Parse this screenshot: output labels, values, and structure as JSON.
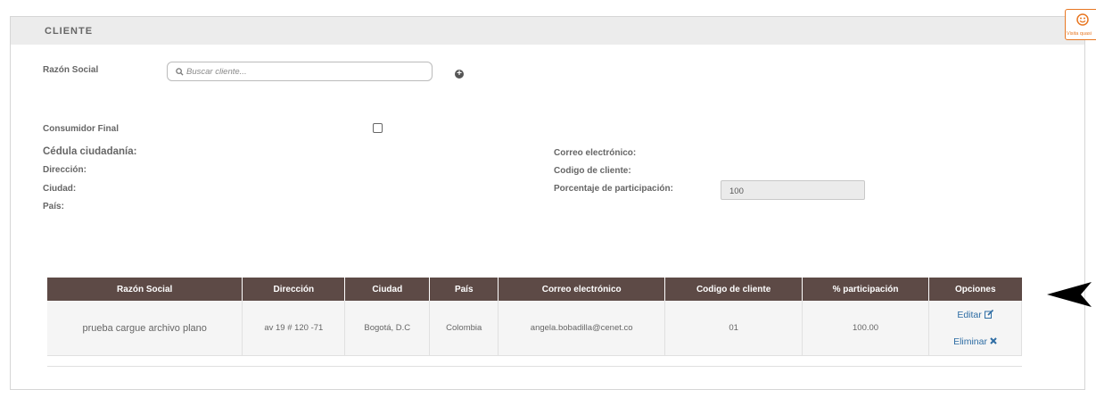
{
  "panel": {
    "title": "CLIENTE"
  },
  "form": {
    "razon_social_label": "Razón Social",
    "search_placeholder": "Buscar cliente...",
    "consumidor_final_label": "Consumidor Final",
    "cedula_label": "Cédula ciudadanía:",
    "direccion_label": "Dirección:",
    "ciudad_label": "Ciudad:",
    "pais_label": "País:",
    "correo_label": "Correo electrónico:",
    "codigo_label": "Codigo de cliente:",
    "porcentaje_label": "Porcentaje de participación:",
    "porcentaje_value": "100"
  },
  "table": {
    "headers": [
      "Razón Social",
      "Dirección",
      "Ciudad",
      "País",
      "Correo electrónico",
      "Codigo de cliente",
      "% participación",
      "Opciones"
    ],
    "rows": [
      {
        "razon_social": "prueba cargue archivo plano",
        "direccion": "av 19 # 120 -71",
        "ciudad": "Bogotá, D.C",
        "pais": "Colombia",
        "correo": "angela.bobadilla@cenet.co",
        "codigo": "01",
        "participacion": "100.00",
        "editar_label": "Editar",
        "eliminar_label": "Eliminar"
      }
    ]
  },
  "widget": {
    "label": "Visita quasi",
    "icon": "smiley-icon"
  },
  "colors": {
    "header_bg": "#5d4a46",
    "link": "#2e6da4",
    "widget": "#e87722"
  }
}
